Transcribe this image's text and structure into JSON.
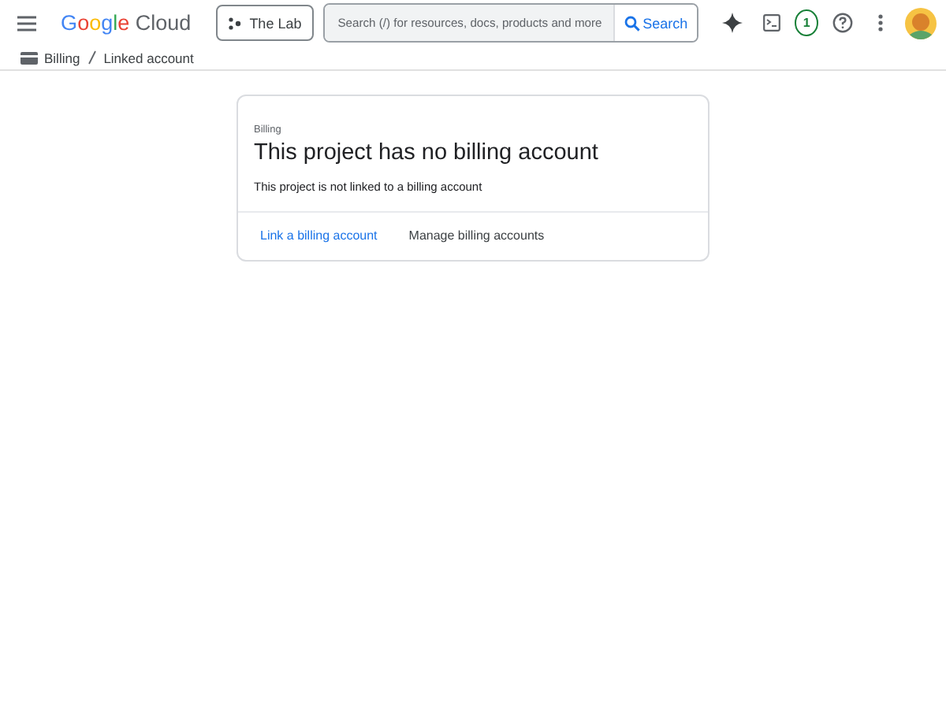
{
  "header": {
    "logo": "Google Cloud",
    "project": "The Lab",
    "search": {
      "placeholder": "Search (/) for resources, docs, products and more",
      "button": "Search"
    },
    "notifications": "1"
  },
  "breadcrumb": [
    "Billing",
    "Linked account"
  ],
  "card": {
    "eyebrow": "Billing",
    "title": "This project has no billing account",
    "message": "This project is not linked to a billing account",
    "actions": [
      {
        "label": "Link a billing account",
        "kind": "primary"
      },
      {
        "label": "Manage billing accounts",
        "kind": "secondary"
      }
    ]
  }
}
